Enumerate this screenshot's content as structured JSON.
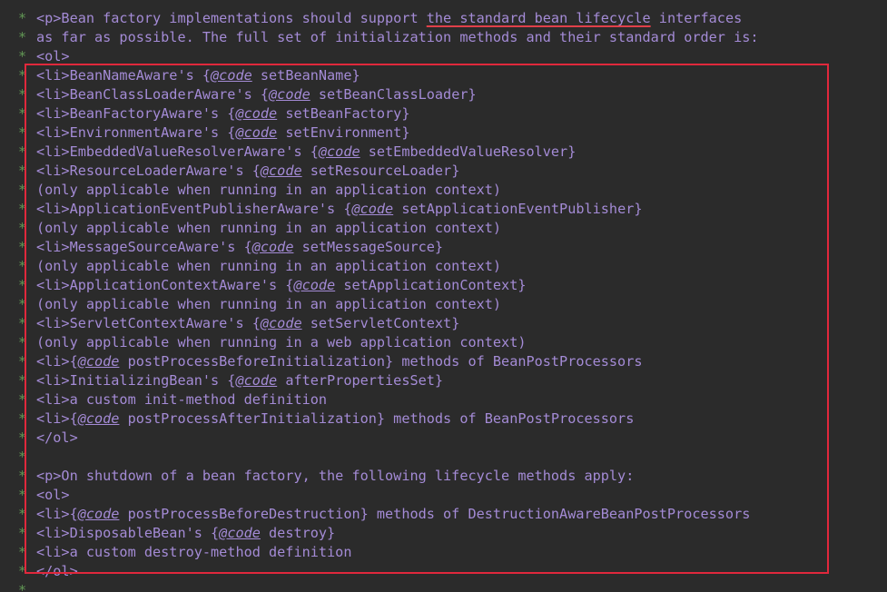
{
  "editor": {
    "gutter_char": "*",
    "lines": [
      {
        "segments": []
      },
      {
        "segments": [
          {
            "t": "<p>Bean factory implementations should support "
          },
          {
            "t": "the standard bean lifecycle",
            "u": true
          },
          {
            "t": " interfaces"
          }
        ]
      },
      {
        "segments": [
          {
            "t": "as far as possible. The full set of initialization methods and their standard order is:"
          }
        ]
      },
      {
        "segments": [
          {
            "t": "<ol>"
          }
        ]
      },
      {
        "segments": [
          {
            "t": "<li>BeanNameAware's {"
          },
          {
            "t": "@code",
            "c": true
          },
          {
            "t": " setBeanName}"
          }
        ]
      },
      {
        "segments": [
          {
            "t": "<li>BeanClassLoaderAware's {"
          },
          {
            "t": "@code",
            "c": true
          },
          {
            "t": " setBeanClassLoader}"
          }
        ]
      },
      {
        "segments": [
          {
            "t": "<li>BeanFactoryAware's {"
          },
          {
            "t": "@code",
            "c": true
          },
          {
            "t": " setBeanFactory}"
          }
        ]
      },
      {
        "segments": [
          {
            "t": "<li>EnvironmentAware's {"
          },
          {
            "t": "@code",
            "c": true
          },
          {
            "t": " setEnvironment}"
          }
        ]
      },
      {
        "segments": [
          {
            "t": "<li>EmbeddedValueResolverAware's {"
          },
          {
            "t": "@code",
            "c": true
          },
          {
            "t": " setEmbeddedValueResolver}"
          }
        ]
      },
      {
        "segments": [
          {
            "t": "<li>ResourceLoaderAware's {"
          },
          {
            "t": "@code",
            "c": true
          },
          {
            "t": " setResourceLoader}"
          }
        ]
      },
      {
        "segments": [
          {
            "t": "(only applicable when running in an application context)"
          }
        ]
      },
      {
        "segments": [
          {
            "t": "<li>ApplicationEventPublisherAware's {"
          },
          {
            "t": "@code",
            "c": true
          },
          {
            "t": " setApplicationEventPublisher}"
          }
        ]
      },
      {
        "segments": [
          {
            "t": "(only applicable when running in an application context)"
          }
        ]
      },
      {
        "segments": [
          {
            "t": "<li>MessageSourceAware's {"
          },
          {
            "t": "@code",
            "c": true
          },
          {
            "t": " setMessageSource}"
          }
        ]
      },
      {
        "segments": [
          {
            "t": "(only applicable when running in an application context)"
          }
        ]
      },
      {
        "segments": [
          {
            "t": "<li>ApplicationContextAware's {"
          },
          {
            "t": "@code",
            "c": true
          },
          {
            "t": " setApplicationContext}"
          }
        ]
      },
      {
        "segments": [
          {
            "t": "(only applicable when running in an application context)"
          }
        ]
      },
      {
        "segments": [
          {
            "t": "<li>ServletContextAware's {"
          },
          {
            "t": "@code",
            "c": true
          },
          {
            "t": " setServletContext}"
          }
        ]
      },
      {
        "segments": [
          {
            "t": "(only applicable when running in a web application context)"
          }
        ]
      },
      {
        "segments": [
          {
            "t": "<li>{"
          },
          {
            "t": "@code",
            "c": true
          },
          {
            "t": " postProcessBeforeInitialization} methods of BeanPostProcessors"
          }
        ]
      },
      {
        "segments": [
          {
            "t": "<li>InitializingBean's {"
          },
          {
            "t": "@code",
            "c": true
          },
          {
            "t": " afterPropertiesSet}"
          }
        ]
      },
      {
        "segments": [
          {
            "t": "<li>a custom init-method definition"
          }
        ]
      },
      {
        "segments": [
          {
            "t": "<li>{"
          },
          {
            "t": "@code",
            "c": true
          },
          {
            "t": " postProcessAfterInitialization} methods of BeanPostProcessors"
          }
        ]
      },
      {
        "segments": [
          {
            "t": "</ol>"
          }
        ]
      },
      {
        "segments": []
      },
      {
        "segments": [
          {
            "t": "<p>On shutdown of a bean factory, the following lifecycle methods apply:"
          }
        ]
      },
      {
        "segments": [
          {
            "t": "<ol>"
          }
        ]
      },
      {
        "segments": [
          {
            "t": "<li>{"
          },
          {
            "t": "@code",
            "c": true
          },
          {
            "t": " postProcessBeforeDestruction} methods of DestructionAwareBeanPostProcessors"
          }
        ]
      },
      {
        "segments": [
          {
            "t": "<li>DisposableBean's {"
          },
          {
            "t": "@code",
            "c": true
          },
          {
            "t": " destroy}"
          }
        ]
      },
      {
        "segments": [
          {
            "t": "<li>a custom destroy-method definition"
          }
        ]
      },
      {
        "segments": [
          {
            "t": "</ol>"
          }
        ]
      },
      {
        "segments": []
      }
    ]
  },
  "colors": {
    "background": "#2b2b2b",
    "comment_star": "#629755",
    "doc_text": "#a48bd6",
    "highlight_box": "#e0283c",
    "underline": "#e0404a"
  }
}
